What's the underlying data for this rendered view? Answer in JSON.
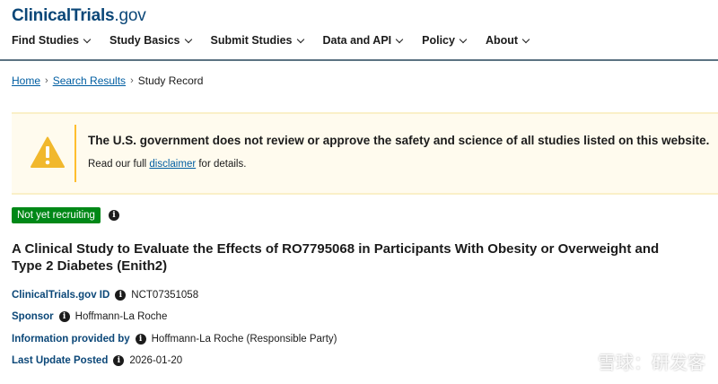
{
  "header": {
    "logo_bold": "ClinicalTrials",
    "logo_suffix": ".gov",
    "nav": [
      {
        "label": "Find Studies"
      },
      {
        "label": "Study Basics"
      },
      {
        "label": "Submit Studies"
      },
      {
        "label": "Data and API"
      },
      {
        "label": "Policy"
      },
      {
        "label": "About"
      }
    ]
  },
  "breadcrumb": {
    "home": "Home",
    "search_results": "Search Results",
    "current": "Study Record",
    "separator": "›"
  },
  "alert": {
    "title": "The U.S. government does not review or approve the safety and science of all studies listed on this website.",
    "body_prefix": "Read our full ",
    "link": "disclaimer",
    "body_suffix": " for details.",
    "icon": "warning-icon",
    "icon_color": "#f1b82d"
  },
  "study": {
    "status": "Not yet recruiting",
    "status_color": "#008817",
    "title": "A Clinical Study to Evaluate the Effects of RO7795068 in Participants With Obesity or Overweight and Type 2 Diabetes (Enith2)",
    "fields": [
      {
        "label": "ClinicalTrials.gov ID",
        "value": "NCT07351058"
      },
      {
        "label": "Sponsor",
        "value": "Hoffmann-La Roche"
      },
      {
        "label": "Information provided by",
        "value": "Hoffmann-La Roche (Responsible Party)"
      },
      {
        "label": "Last Update Posted",
        "value": "2026-01-20"
      }
    ]
  },
  "watermark": {
    "text": "雪球：研发客",
    "icon": "snowball-logo-icon"
  }
}
